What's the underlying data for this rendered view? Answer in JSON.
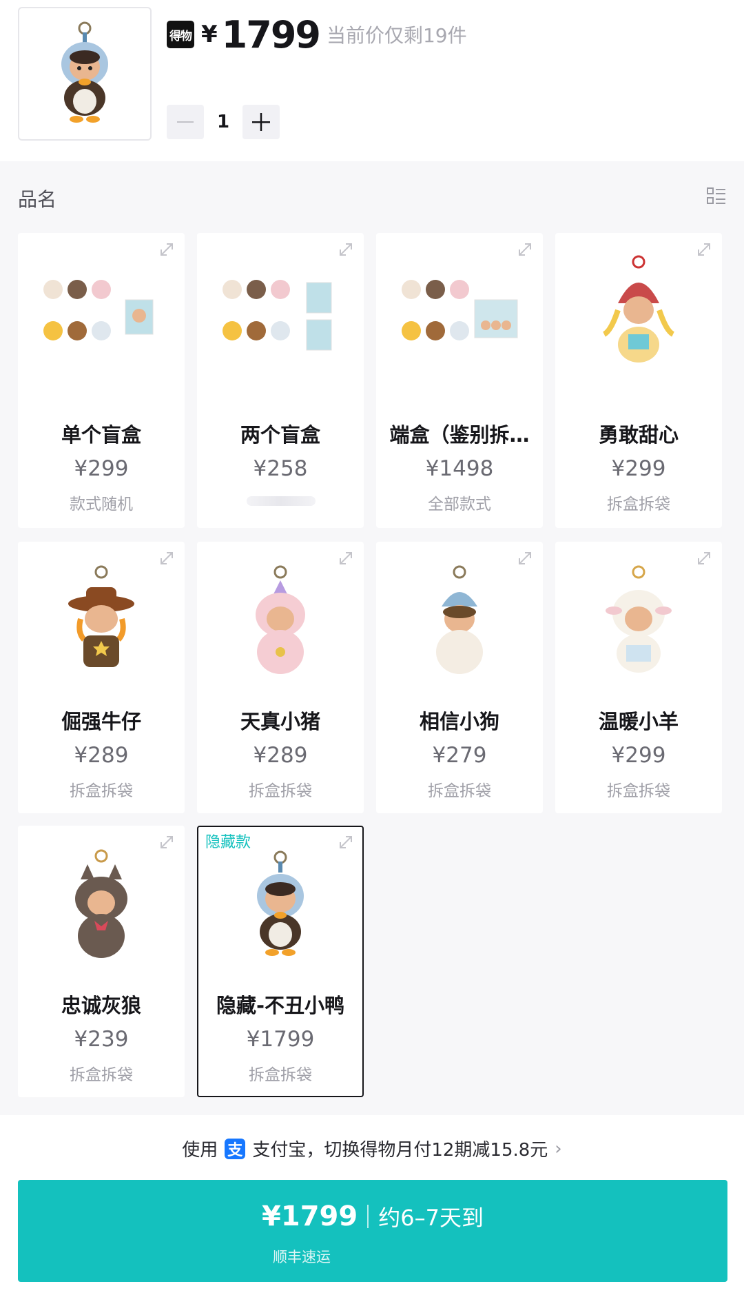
{
  "header": {
    "brand_badge": "得物",
    "currency": "¥",
    "price": "1799",
    "stock_note": "当前价仅剩19件",
    "quantity": "1",
    "minus_label": "−",
    "plus_label": "+"
  },
  "section": {
    "label": "品名"
  },
  "items": [
    {
      "name": "单个盲盒",
      "price": "¥299",
      "sub": "款式随机"
    },
    {
      "name": "两个盲盒",
      "price": "¥258",
      "sub": ""
    },
    {
      "name": "端盒（鉴别拆…",
      "price": "¥1498",
      "sub": "全部款式"
    },
    {
      "name": "勇敢甜心",
      "price": "¥299",
      "sub": "拆盒拆袋"
    },
    {
      "name": "倔强牛仔",
      "price": "¥289",
      "sub": "拆盒拆袋"
    },
    {
      "name": "天真小猪",
      "price": "¥289",
      "sub": "拆盒拆袋"
    },
    {
      "name": "相信小狗",
      "price": "¥279",
      "sub": "拆盒拆袋"
    },
    {
      "name": "温暖小羊",
      "price": "¥299",
      "sub": "拆盒拆袋"
    },
    {
      "name": "忠诚灰狼",
      "price": "¥239",
      "sub": "拆盒拆袋"
    },
    {
      "name": "隐藏-不丑小鸭",
      "price": "¥1799",
      "sub": "拆盒拆袋",
      "tag": "隐藏款",
      "selected": true
    }
  ],
  "promo": {
    "prefix": "使用",
    "alipay_icon": "支",
    "text": "支付宝，切换得物月付12期减15.8元",
    "chevron": "›"
  },
  "buy": {
    "price": "¥1799",
    "eta": "约6–7天到",
    "carrier": "顺丰速运"
  },
  "colors": {
    "accent": "#14c1be",
    "alipay": "#1677ff",
    "text": "#16161a"
  }
}
